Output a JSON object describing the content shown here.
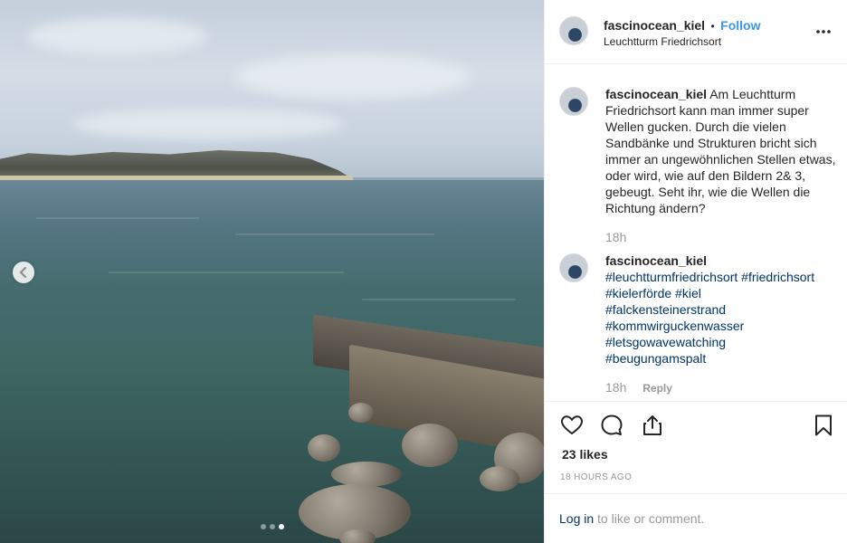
{
  "post": {
    "username": "fascinocean_kiel",
    "separator": "•",
    "follow_label": "Follow",
    "location": "Leuchtturm Friedrichsort",
    "more_icon": "ellipsis-icon"
  },
  "caption": {
    "username": "fascinocean_kiel",
    "text": "Am Leuchtturm Friedrichsort kann man immer super Wellen gucken. Durch die vielen Sandbänke und Strukturen bricht sich immer an ungewöhnlichen Stellen etwas, oder wird, wie auf den Bildern 2& 3, gebeugt. Seht ihr, wie die Wellen die Richtung ändern?",
    "time": "18h"
  },
  "comment": {
    "username": "fascinocean_kiel",
    "hashtags": [
      "#leuchtturmfriedrichsort",
      "#friedrichsort",
      "#kielerförde",
      "#kiel",
      "#falckensteinerstrand",
      "#kommwirguckenwasser",
      "#letsgowavewatching",
      "#beugungamspalt"
    ],
    "time": "18h",
    "reply_label": "Reply"
  },
  "actions": {
    "like_icon": "heart-icon",
    "comment_icon": "comment-icon",
    "share_icon": "share-icon",
    "save_icon": "bookmark-icon"
  },
  "likes": "23 likes",
  "timestamp": "18 HOURS AGO",
  "login": {
    "link_text": "Log in",
    "rest_text": " to like or comment."
  },
  "carousel": {
    "total": 3,
    "active": 3
  },
  "colors": {
    "link_blue": "#3897f0",
    "hashtag_blue": "#003569",
    "muted": "#999999"
  }
}
